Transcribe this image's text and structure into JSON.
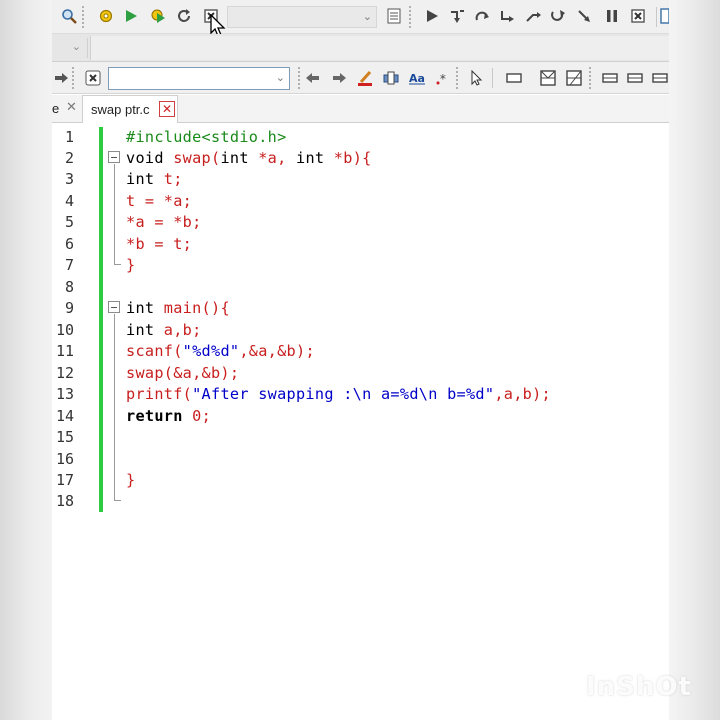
{
  "toolbar": {
    "icons_row1": [
      "zoom-icon",
      "settings-gear-icon",
      "run-icon",
      "compile-icon",
      "rebuild-icon",
      "stop-icon",
      "dropdown",
      "document-icon",
      "debug-run-icon",
      "step-into-icon",
      "step-over-icon",
      "step-out-icon",
      "continue-icon",
      "pause-icon",
      "close-debug-icon"
    ],
    "search_combo_value": ""
  },
  "tabs": {
    "previous_tab_label": "e",
    "active_tab_label": "swap ptr.c"
  },
  "editor": {
    "lines": [
      {
        "n": "1",
        "text": "#include<stdio.h>"
      },
      {
        "n": "2",
        "kw1": "void",
        "rest": " swap(",
        "kw2": "int",
        "mid": " *a, ",
        "kw3": "int",
        "end": " *b){"
      },
      {
        "n": "3",
        "kw": "int",
        "rest": " t;"
      },
      {
        "n": "4",
        "text": "t = *a;"
      },
      {
        "n": "5",
        "text": "*a = *b;"
      },
      {
        "n": "6",
        "text": "*b = t;"
      },
      {
        "n": "7",
        "text": "}"
      },
      {
        "n": "8",
        "text": ""
      },
      {
        "n": "9",
        "kw": "int",
        "rest": " main(){"
      },
      {
        "n": "10",
        "kw": "int",
        "rest": " a,b;"
      },
      {
        "n": "11",
        "fn": "scanf(",
        "str": "\"%d%d\"",
        "rest": ",&a,&b);"
      },
      {
        "n": "12",
        "text": "swap(&a,&b);"
      },
      {
        "n": "13",
        "fn": "printf(",
        "str": "\"After swapping :\\n a=%d\\n b=%d\"",
        "rest": ",a,b);"
      },
      {
        "n": "14",
        "kw": "return",
        "sp": " ",
        "num": "0",
        "rest": ";"
      },
      {
        "n": "15",
        "text": ""
      },
      {
        "n": "16",
        "text": ""
      },
      {
        "n": "17",
        "text": "}"
      },
      {
        "n": "18",
        "text": ""
      }
    ]
  },
  "watermark": "InShOt",
  "colors": {
    "preprocessor": "#1a8a1a",
    "keyword": "#000000",
    "punct": "#c81e1e",
    "string": "#0000c8",
    "modified_bar": "#2ecc40"
  }
}
